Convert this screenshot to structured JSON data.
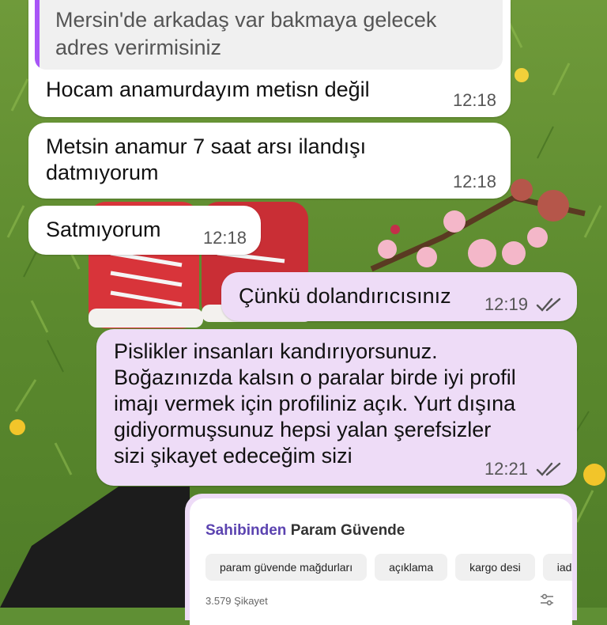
{
  "conversation": {
    "quoted_reply": {
      "quote_line1": "Mersin'de arkadaş var bakmaya gelecek",
      "quote_line2": "adres verirmisiniz",
      "reply_text": "Hocam anamurdayım metisn değil",
      "time": "12:18"
    },
    "messages": [
      {
        "lines": [
          "Metsin anamur 7 saat arsı ilandışı",
          "datmıyorum"
        ],
        "time": "12:18",
        "direction": "incoming"
      },
      {
        "lines": [
          "Satmıyorum"
        ],
        "time": "12:18",
        "direction": "incoming"
      },
      {
        "lines": [
          "Çünkü dolandırıcısınız"
        ],
        "time": "12:19",
        "direction": "outgoing",
        "status": "read"
      },
      {
        "lines": [
          "Pislikler insanları kandırıyorsunuz.",
          "Boğazınızda kalsın o paralar birde iyi profil",
          "imajı vermek için profiliniz açık. Yurt dışına",
          "gidiyormuşsunuz hepsi yalan şerefsizler",
          "sizi şikayet edeceğim sizi"
        ],
        "time": "12:21",
        "direction": "outgoing",
        "status": "read"
      }
    ],
    "image_attachment": {
      "brand_part1": "Sahibinden",
      "brand_part2": "Param Güvende",
      "chips": [
        "param güvende mağdurları",
        "açıklama",
        "kargo desi",
        "iad"
      ],
      "complaint_count": "3.579 Şikayet",
      "filter_icon": "sliders-icon"
    },
    "colors": {
      "incoming_bubble": "#ffffff",
      "outgoing_bubble": "#eedcf7",
      "quote_accent": "#a855f7",
      "brand_accent": "#5b43b0",
      "read_ticks": "#555555"
    }
  }
}
